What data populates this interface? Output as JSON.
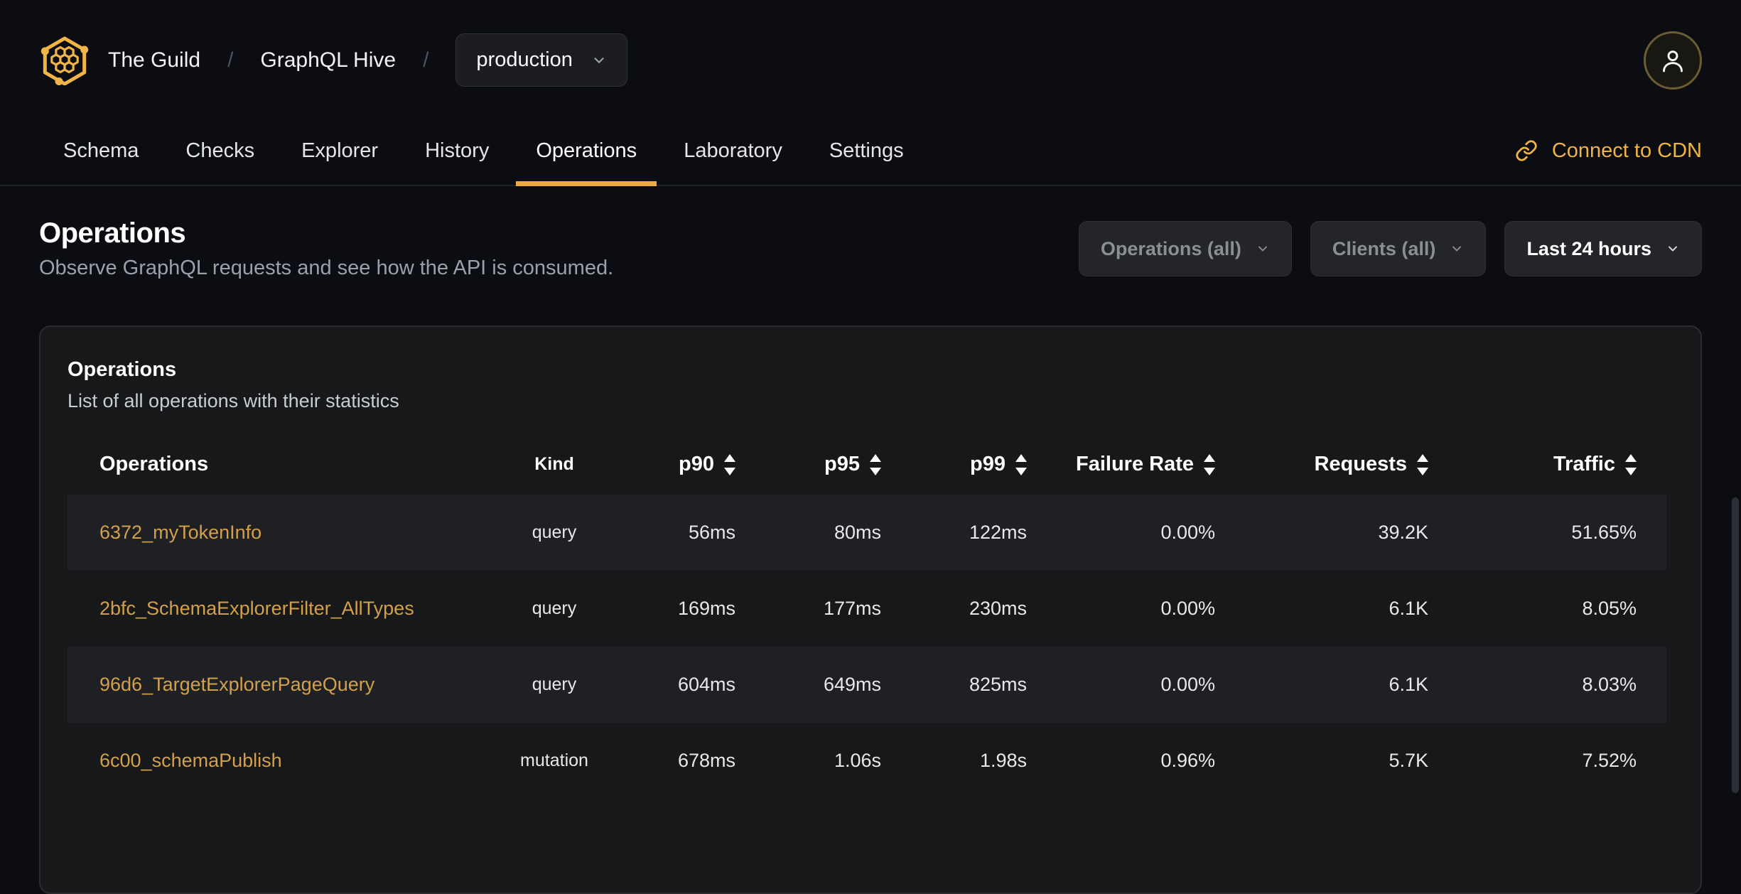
{
  "brand": {
    "org": "The Guild",
    "separator": "/",
    "project": "GraphQL Hive",
    "target": "production"
  },
  "nav": {
    "tabs": [
      {
        "label": "Schema",
        "active": false
      },
      {
        "label": "Checks",
        "active": false
      },
      {
        "label": "Explorer",
        "active": false
      },
      {
        "label": "History",
        "active": false
      },
      {
        "label": "Operations",
        "active": true
      },
      {
        "label": "Laboratory",
        "active": false
      },
      {
        "label": "Settings",
        "active": false
      }
    ],
    "cdn_link": "Connect to CDN"
  },
  "page_header": {
    "title": "Operations",
    "subtitle": "Observe GraphQL requests and see how the API is consumed."
  },
  "filters": {
    "operations": "Operations (all)",
    "clients": "Clients (all)",
    "period": "Last 24 hours"
  },
  "card": {
    "title": "Operations",
    "subtitle": "List of all operations with their statistics"
  },
  "table": {
    "columns": [
      {
        "label": "Operations",
        "sortable": false
      },
      {
        "label": "Kind",
        "sortable": false
      },
      {
        "label": "p90",
        "sortable": true
      },
      {
        "label": "p95",
        "sortable": true
      },
      {
        "label": "p99",
        "sortable": true
      },
      {
        "label": "Failure Rate",
        "sortable": true
      },
      {
        "label": "Requests",
        "sortable": true
      },
      {
        "label": "Traffic",
        "sortable": true
      }
    ],
    "rows": [
      {
        "operation": "6372_myTokenInfo",
        "kind": "query",
        "p90": "56ms",
        "p95": "80ms",
        "p99": "122ms",
        "failure_rate": "0.00%",
        "requests": "39.2K",
        "traffic": "51.65%"
      },
      {
        "operation": "2bfc_SchemaExplorerFilter_AllTypes",
        "kind": "query",
        "p90": "169ms",
        "p95": "177ms",
        "p99": "230ms",
        "failure_rate": "0.00%",
        "requests": "6.1K",
        "traffic": "8.05%"
      },
      {
        "operation": "96d6_TargetExplorerPageQuery",
        "kind": "query",
        "p90": "604ms",
        "p95": "649ms",
        "p99": "825ms",
        "failure_rate": "0.00%",
        "requests": "6.1K",
        "traffic": "8.03%"
      },
      {
        "operation": "6c00_schemaPublish",
        "kind": "mutation",
        "p90": "678ms",
        "p95": "1.06s",
        "p99": "1.98s",
        "failure_rate": "0.96%",
        "requests": "5.7K",
        "traffic": "7.52%"
      }
    ]
  },
  "colors": {
    "accent_gold": "#eeab44",
    "link_gold": "#d2a04c",
    "page_bg": "#0b0d13",
    "card_bg": "#17181a",
    "row_alt_bg": "#1f2024"
  }
}
